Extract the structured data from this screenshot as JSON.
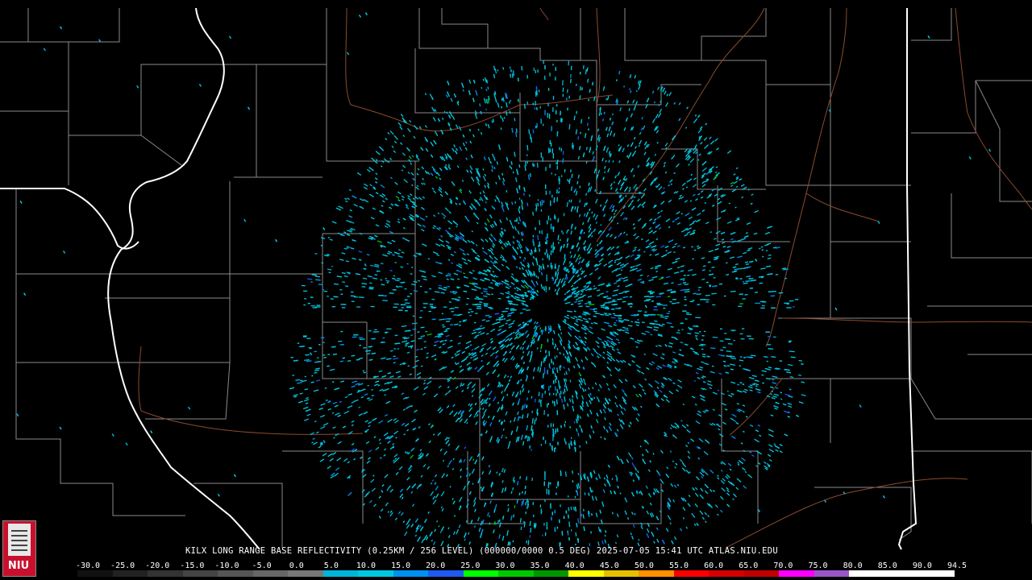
{
  "caption": "KILX LONG RANGE BASE REFLECTIVITY (0.25KM / 256 LEVEL) (000000/0000 0.5 DEG) 2025-07-05 15:41 UTC  ATLAS.NIU.EDU",
  "logo_text": "NIU",
  "scale": {
    "labels": [
      "-30.0",
      "-25.0",
      "-20.0",
      "-15.0",
      "-10.0",
      "-5.0",
      "0.0",
      "5.0",
      "10.0",
      "15.0",
      "20.0",
      "25.0",
      "30.0",
      "35.0",
      "40.0",
      "45.0",
      "50.0",
      "55.0",
      "60.0",
      "65.0",
      "70.0",
      "75.0",
      "80.0",
      "85.0",
      "90.0",
      "94.5"
    ],
    "colors": [
      "#111111",
      "#222222",
      "#333333",
      "#444444",
      "#555555",
      "#666666",
      "#777777",
      "#00b4d8",
      "#00c8e0",
      "#0090f0",
      "#1e5af0",
      "#00ff00",
      "#00c800",
      "#009600",
      "#ffff00",
      "#e6c000",
      "#ff9000",
      "#ff0000",
      "#d40000",
      "#c00000",
      "#ff00ff",
      "#9955c8",
      "#ffffff",
      "#ffffff",
      "#ffffff"
    ]
  },
  "radar": {
    "site": "KILX",
    "dominant_colors": [
      "#00c8e0",
      "#00b4d8",
      "#0090f0",
      "#1e5af0",
      "#00c800"
    ]
  }
}
